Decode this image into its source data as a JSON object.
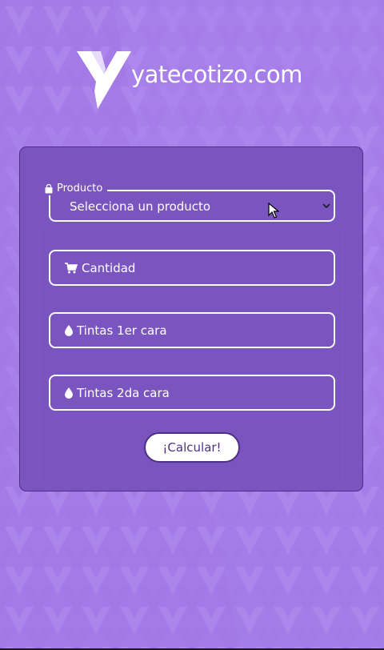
{
  "brand": {
    "name": "yatecotizo.com"
  },
  "form": {
    "producto": {
      "legend": "Producto",
      "selected_value": "Selecciona un producto"
    },
    "cantidad": {
      "placeholder": "Cantidad"
    },
    "tintas_1": {
      "placeholder": "Tintas 1er cara"
    },
    "tintas_2": {
      "placeholder": "Tintas 2da cara"
    },
    "submit_label": "¡Calcular!"
  },
  "icons": {
    "legend_icon": "shopping-bag-icon",
    "cantidad_icon": "shopping-cart-icon",
    "tintas_1_icon": "ink-drop-icon",
    "tintas_2_icon": "ink-drop-icon",
    "select_arrow": "chevron-down-icon"
  },
  "colors": {
    "background": "#a57be8",
    "card": "#7a55bf",
    "accent_dark": "#4c2f86",
    "text_light": "#ffffff"
  }
}
